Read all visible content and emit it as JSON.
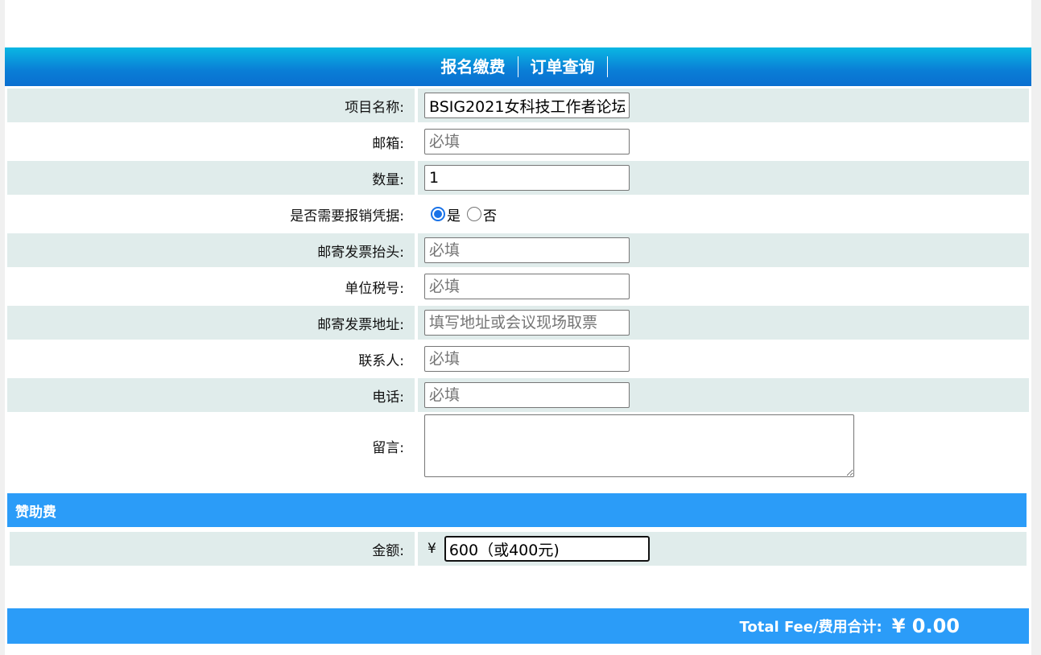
{
  "nav": {
    "items": [
      "报名缴费",
      "订单查询"
    ]
  },
  "form": {
    "project_name": {
      "label": "项目名称:",
      "value": "BSIG2021女科技工作者论坛"
    },
    "email": {
      "label": "邮箱:",
      "placeholder": "必填"
    },
    "quantity": {
      "label": "数量:",
      "value": "1"
    },
    "need_receipt": {
      "label": "是否需要报销凭据:",
      "options": [
        "是",
        "否"
      ],
      "selected": "是"
    },
    "invoice_title": {
      "label": "邮寄发票抬头:",
      "placeholder": "必填"
    },
    "tax_id": {
      "label": "单位税号:",
      "placeholder": "必填"
    },
    "invoice_address": {
      "label": "邮寄发票地址:",
      "placeholder": "填写地址或会议现场取票"
    },
    "contact": {
      "label": "联系人:",
      "placeholder": "必填"
    },
    "phone": {
      "label": "电话:",
      "placeholder": "必填"
    },
    "message": {
      "label": "留言:",
      "value": ""
    }
  },
  "sponsor": {
    "title": "赞助费",
    "amount_label": "金额:",
    "currency": "¥",
    "amount_value": "600（或400元)"
  },
  "total": {
    "label": "Total Fee/费用合计:",
    "value": "¥ 0.00"
  },
  "colors": {
    "nav_gradient_top": "#0ab7e3",
    "nav_gradient_bottom": "#0a6fd0",
    "section_blue": "#2b9cf8",
    "row_shade": "#e0eceb"
  }
}
